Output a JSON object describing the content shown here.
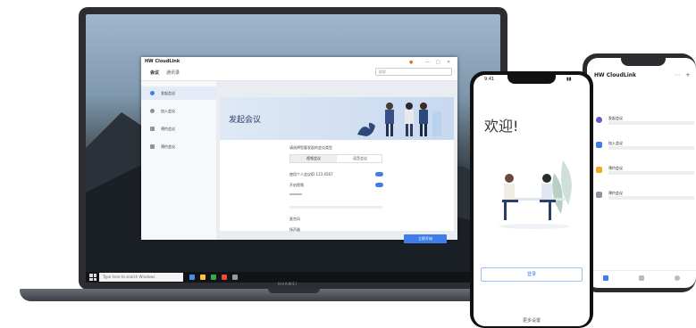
{
  "laptop": {
    "brand": "HUAWEI",
    "taskbar": {
      "search_placeholder": "Type here to search Windows"
    },
    "app": {
      "title": "HW CloudLink",
      "nav": [
        "会议",
        "通讯录"
      ],
      "search_placeholder": "搜索",
      "sidebar": [
        {
          "label": "发起会议",
          "color": "#3f7ee8"
        },
        {
          "label": "加入会议",
          "color": "#8a94a6"
        },
        {
          "label": "预约会议",
          "color": "#8a94a6"
        },
        {
          "label": "预约会议",
          "color": "#8a94a6"
        }
      ],
      "banner_title": "发起会议",
      "form_heading": "请选择您要发起的会议类型",
      "segments": [
        "视频会议",
        "语音会议"
      ],
      "options": [
        "使用个人会议ID 123 4567",
        "开启视频"
      ],
      "links": [
        "麦克风",
        "扬声器"
      ],
      "start_button": "立即开始"
    }
  },
  "phone1": {
    "time": "9:41",
    "welcome": "欢迎!",
    "join_button": "登录",
    "footer": "更多设置"
  },
  "phone2": {
    "title": "HW CloudLink",
    "items": [
      {
        "title": "发起会议",
        "color": "#6a5acd"
      },
      {
        "title": "加入会议",
        "color": "#3f7ee8"
      },
      {
        "title": "预约会议",
        "color": "#f5a623"
      },
      {
        "title": "预约会议",
        "color": "#8a94a6"
      }
    ]
  }
}
